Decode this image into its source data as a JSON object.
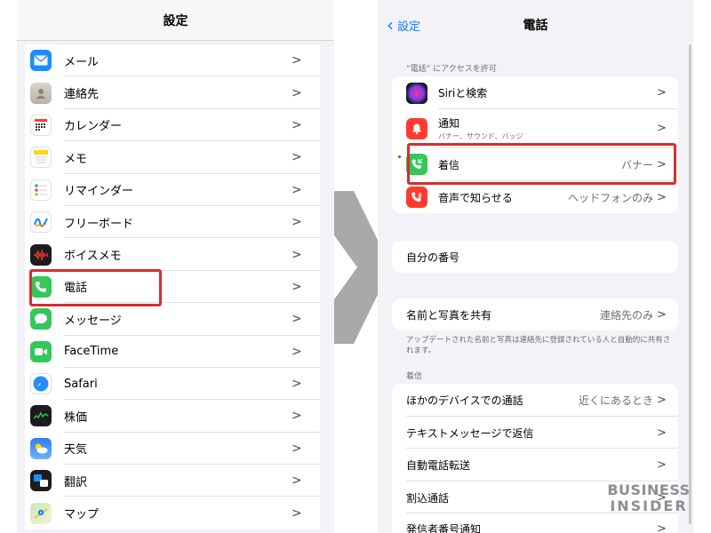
{
  "left": {
    "title": "設定",
    "items": [
      {
        "label": "メール",
        "icon": "mail-icon"
      },
      {
        "label": "連絡先",
        "icon": "contacts-icon"
      },
      {
        "label": "カレンダー",
        "icon": "calendar-icon"
      },
      {
        "label": "メモ",
        "icon": "notes-icon"
      },
      {
        "label": "リマインダー",
        "icon": "reminders-icon"
      },
      {
        "label": "フリーボード",
        "icon": "freeform-icon"
      },
      {
        "label": "ボイスメモ",
        "icon": "voice-memos-icon"
      },
      {
        "label": "電話",
        "icon": "phone-icon"
      },
      {
        "label": "メッセージ",
        "icon": "messages-icon"
      },
      {
        "label": "FaceTime",
        "icon": "facetime-icon"
      },
      {
        "label": "Safari",
        "icon": "safari-icon"
      },
      {
        "label": "株価",
        "icon": "stocks-icon"
      },
      {
        "label": "天気",
        "icon": "weather-icon"
      },
      {
        "label": "翻訳",
        "icon": "translate-icon"
      },
      {
        "label": "マップ",
        "icon": "maps-icon"
      }
    ]
  },
  "right": {
    "back_label": "設定",
    "title": "電話",
    "access_caption": "“電話” にアクセスを許可",
    "access_items": {
      "siri": "Siriと検索",
      "notifications": "通知",
      "notifications_sub": "バナー、サウンド、バッジ",
      "incoming": "着信",
      "incoming_value": "バナー",
      "announce": "音声で知らせる",
      "announce_value": "ヘッドフォンのみ"
    },
    "my_number": "自分の番号",
    "share_name": "名前と写真を共有",
    "share_value": "連絡先のみ",
    "share_footer": "アップデートされた名前と写真は連絡先に登録されている人と自動的に共有されます。",
    "calls_caption": "着信",
    "calls": {
      "other_devices": "ほかのデバイスでの通話",
      "other_devices_value": "近くにあるとき",
      "text_reply": "テキストメッセージで返信",
      "call_forwarding": "自動電話転送",
      "call_waiting": "割込通話",
      "caller_id": "発信者番号通知"
    }
  },
  "watermark": {
    "line1": "BUSINESS",
    "line2": "INSIDER"
  },
  "colors": {
    "highlight": "#d62e2e",
    "link": "#0a84ff",
    "phone_green": "#34c759"
  }
}
